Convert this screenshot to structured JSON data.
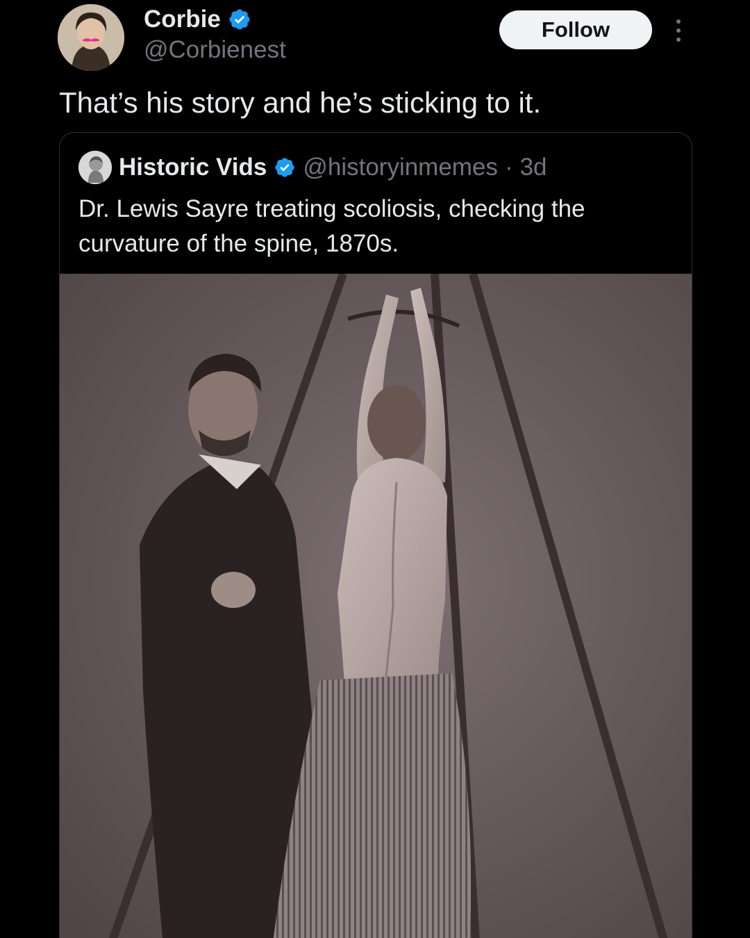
{
  "author": {
    "display_name": "Corbie",
    "handle": "@Corbienest",
    "verified": true
  },
  "follow_button": {
    "label": "Follow"
  },
  "tweet": {
    "text": "That’s his story and he’s sticking to it."
  },
  "quoted_tweet": {
    "display_name": "Historic Vids",
    "handle": "@historyinmemes",
    "separator": "·",
    "time": "3d",
    "verified": true,
    "text": "Dr. Lewis Sayre treating scoliosis, checking the curvature of the spine, 1870s."
  },
  "colors": {
    "background": "#000000",
    "verified_badge": "#1d9bf0",
    "secondary_text": "#71767b",
    "follow_button_bg": "#eff3f4"
  },
  "icons": {
    "verified": "verified-badge-icon",
    "more": "more-vertical-icon"
  }
}
